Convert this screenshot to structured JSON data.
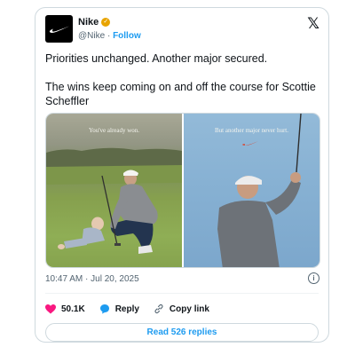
{
  "account": {
    "name": "Nike",
    "handle": "@Nike",
    "separator": "·",
    "follow_label": "Follow",
    "logo_glyph": "𝕏",
    "verified_color": "#e8a400"
  },
  "post": {
    "line1": "Priorities unchanged. Another major secured.",
    "line2": "The wins keep coming on and off the course for Scottie Scheffler"
  },
  "media": {
    "left_caption": "You've already won.",
    "right_caption": "But another major never hurt."
  },
  "meta": {
    "timestamp": "10:47 AM · Jul 20, 2025",
    "info_glyph": "i"
  },
  "actions": {
    "likes": "50.1K",
    "like_color": "#f91880",
    "reply_label": "Reply",
    "reply_color": "#1d9bf0",
    "copy_link_label": "Copy link",
    "read_replies_label": "Read 526 replies"
  }
}
